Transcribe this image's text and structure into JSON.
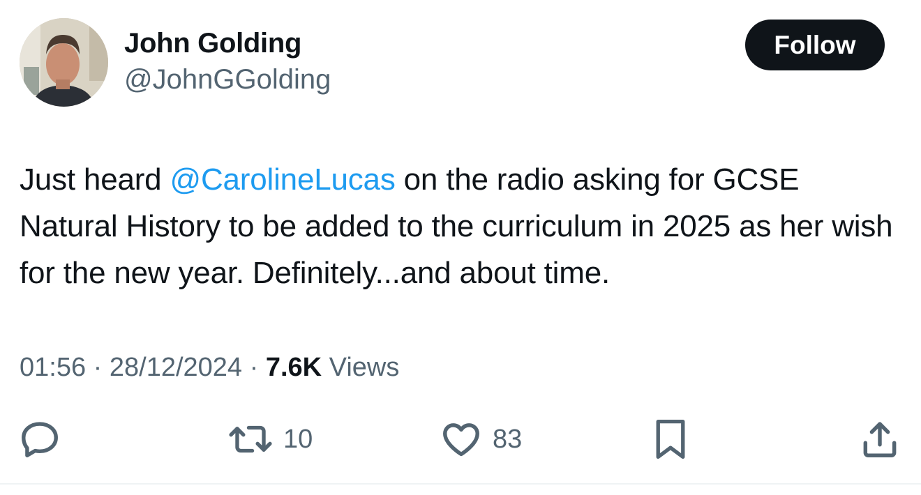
{
  "author": {
    "display_name": "John Golding",
    "handle": "@JohnGGolding"
  },
  "follow_label": "Follow",
  "tweet": {
    "text_before": "Just heard ",
    "mention": "@CarolineLucas",
    "text_after": " on the radio asking for GCSE Natural History to be added to the curriculum in 2025 as her wish for the new year. Definitely...and about time."
  },
  "meta": {
    "time": "01:56",
    "separator": " · ",
    "date": "28/12/2024",
    "views_count": "7.6K",
    "views_label": " Views"
  },
  "actions": {
    "reply_icon": "reply-icon",
    "retweet_icon": "retweet-icon",
    "retweet_count": "10",
    "like_icon": "heart-icon",
    "like_count": "83",
    "bookmark_icon": "bookmark-icon",
    "share_icon": "share-icon"
  },
  "colors": {
    "text": "#0f1419",
    "secondary": "#536471",
    "link": "#1d9bf0",
    "button": "#0f1419"
  }
}
